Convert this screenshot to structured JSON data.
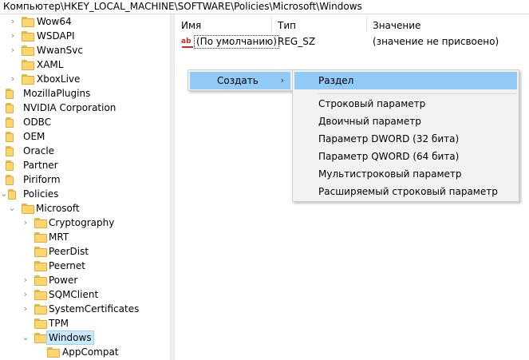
{
  "address": "Компьютер\\HKEY_LOCAL_MACHINE\\SOFTWARE\\Policies\\Microsoft\\Windows",
  "tree": [
    {
      "label": "Wow64",
      "chev": "›"
    },
    {
      "label": "WSDAPI",
      "chev": "›"
    },
    {
      "label": "WwanSvc",
      "chev": "›"
    },
    {
      "label": "XAML",
      "chev": ""
    },
    {
      "label": "XboxLive",
      "chev": "›"
    },
    {
      "label": "MozillaPlugins",
      "chev": ""
    },
    {
      "label": "NVIDIA Corporation",
      "chev": ""
    },
    {
      "label": "ODBC",
      "chev": ""
    },
    {
      "label": "OEM",
      "chev": ""
    },
    {
      "label": "Oracle",
      "chev": ""
    },
    {
      "label": "Partner",
      "chev": ""
    },
    {
      "label": "Piriform",
      "chev": ""
    },
    {
      "label": "Policies",
      "chev": "⌄"
    },
    {
      "label": "Microsoft",
      "chev": "⌄"
    },
    {
      "label": "Cryptography",
      "chev": "›"
    },
    {
      "label": "MRT",
      "chev": ""
    },
    {
      "label": "PeerDist",
      "chev": ""
    },
    {
      "label": "Peernet",
      "chev": ""
    },
    {
      "label": "Power",
      "chev": "›"
    },
    {
      "label": "SQMClient",
      "chev": "›"
    },
    {
      "label": "SystemCertificates",
      "chev": "›"
    },
    {
      "label": "TPM",
      "chev": ""
    },
    {
      "label": "Windows",
      "chev": "⌄"
    },
    {
      "label": "AppCompat",
      "chev": ""
    }
  ],
  "columns": {
    "name": "Имя",
    "type": "Тип",
    "value": "Значение"
  },
  "value_row": {
    "icon": "ab",
    "name": "(По умолчанию)",
    "type": "REG_SZ",
    "data": "(значение не присвоено)"
  },
  "context_menu": {
    "create_label": "Создать",
    "create_arrow": "›"
  },
  "submenu": {
    "section": "Раздел",
    "items": [
      "Строковый параметр",
      "Двоичный параметр",
      "Параметр DWORD (32 бита)",
      "Параметр QWORD (64 бита)",
      "Мультистроковый параметр",
      "Расширяемый строковый параметр"
    ]
  }
}
